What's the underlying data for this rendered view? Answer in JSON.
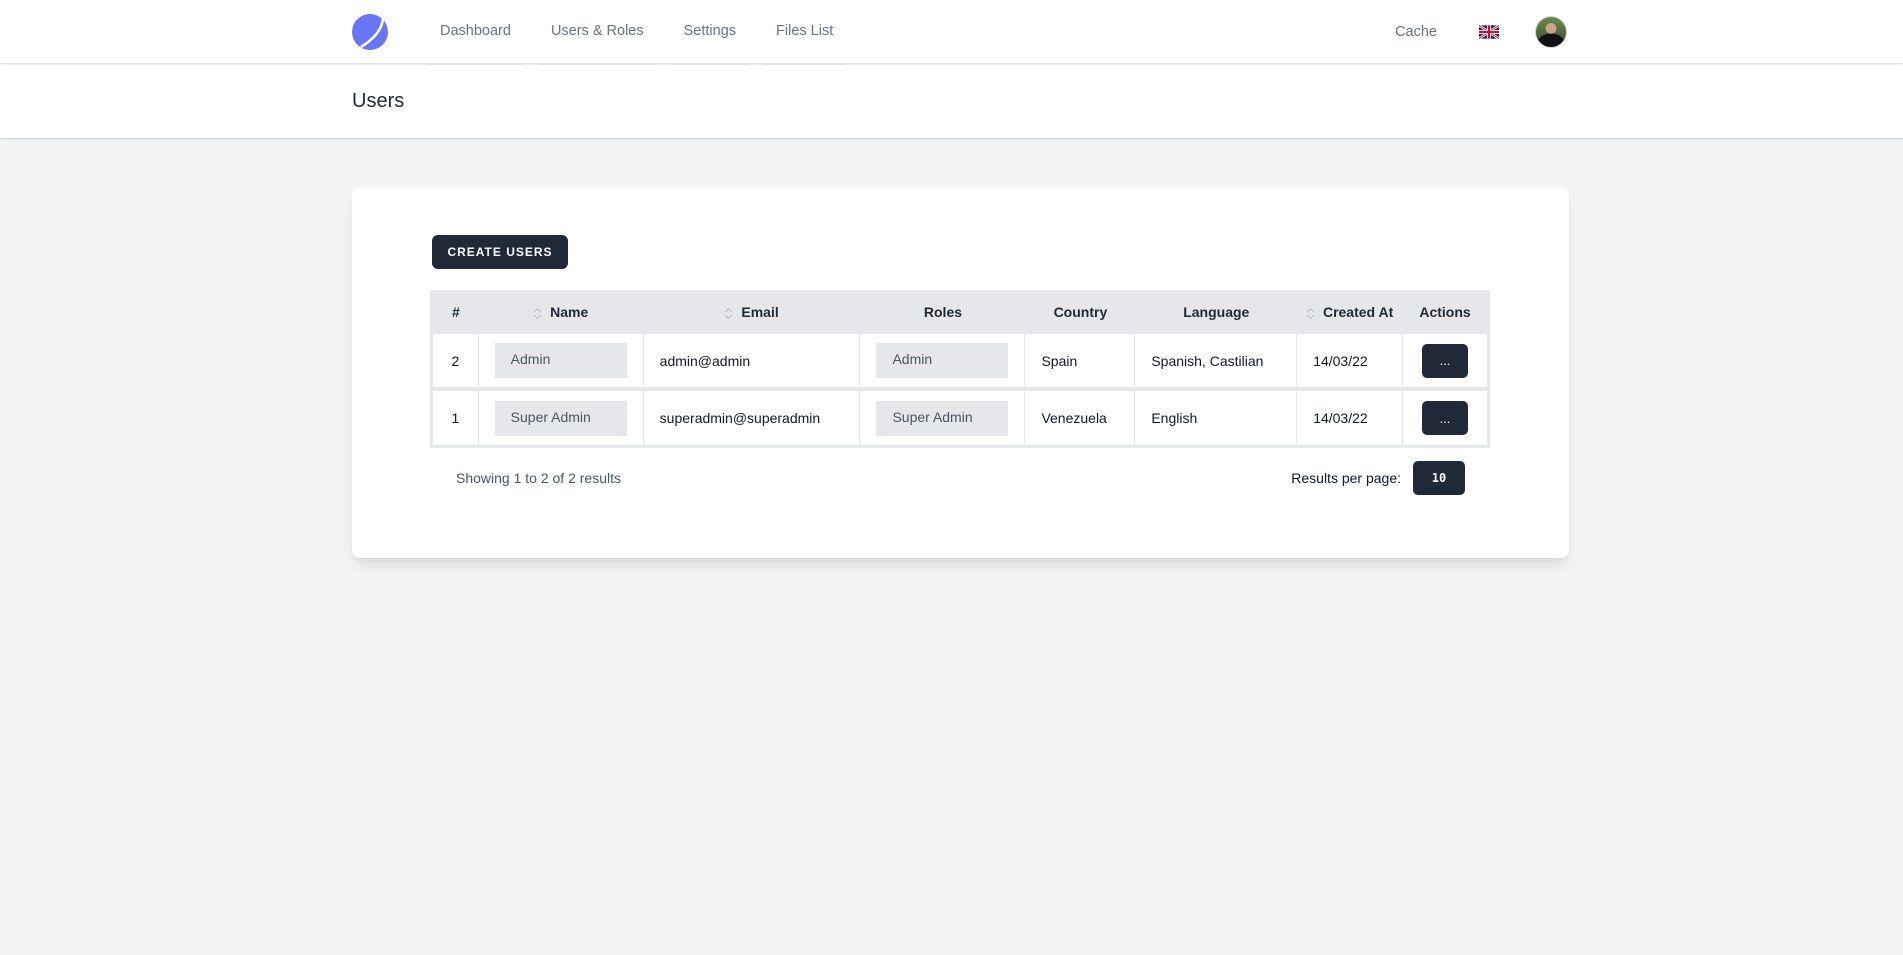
{
  "nav": {
    "logo": "app-logo",
    "links": [
      {
        "label": "Dashboard"
      },
      {
        "label": "Users & Roles"
      },
      {
        "label": "Settings"
      },
      {
        "label": "Files List"
      }
    ],
    "cache_label": "Cache",
    "language_flag": "uk-flag-icon",
    "avatar": "user-avatar"
  },
  "header": {
    "title": "Users"
  },
  "toolbar": {
    "create_label": "CREATE USERS"
  },
  "table": {
    "columns": [
      {
        "label": "#",
        "sortable": false
      },
      {
        "label": "Name",
        "sortable": true
      },
      {
        "label": "Email",
        "sortable": true
      },
      {
        "label": "Roles",
        "sortable": false
      },
      {
        "label": "Country",
        "sortable": false
      },
      {
        "label": "Language",
        "sortable": false
      },
      {
        "label": "Created At",
        "sortable": true
      },
      {
        "label": "Actions",
        "sortable": false
      }
    ],
    "rows": [
      {
        "id": "2",
        "name": "Admin",
        "email": "admin@admin",
        "role": "Admin",
        "country": "Spain",
        "language": "Spanish, Castilian",
        "created_at": "14/03/22",
        "action_label": "..."
      },
      {
        "id": "1",
        "name": "Super Admin",
        "email": "superadmin@superadmin",
        "role": "Super Admin",
        "country": "Venezuela",
        "language": "English",
        "created_at": "14/03/22",
        "action_label": "..."
      }
    ]
  },
  "pagination": {
    "summary": "Showing 1 to 2 of 2 results",
    "per_page_label": "Results per page:",
    "per_page_value": "10"
  },
  "colors": {
    "brand": "#6875f5",
    "primary_button": "#1f2937",
    "background": "#f3f4f6",
    "table_header": "#e5e7eb"
  }
}
